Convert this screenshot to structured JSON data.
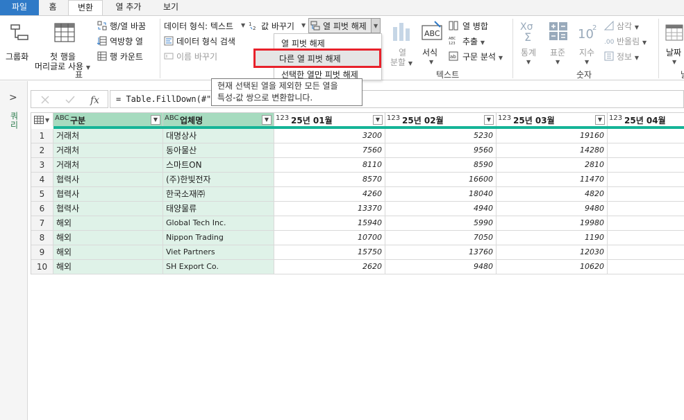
{
  "tabs": {
    "file": "파일",
    "home": "홈",
    "transform": "변환",
    "add_column": "열 추가",
    "view": "보기"
  },
  "ribbon": {
    "group_by": "그룹화",
    "use_first_row_1": "첫 행을",
    "use_first_row_2": "머리글로 사용",
    "transpose": "행/열 바꿈",
    "reverse_rows": "역방향 열",
    "count_rows": "행 카운트",
    "table_group": "표",
    "data_type": "데이터 형식: 텍스트",
    "detect_type": "데이터 형식 검색",
    "rename": "이름 바꾸기",
    "replace_values": "값 바꾸기",
    "unpivot": "열 피벗 해제",
    "split_col_1": "열",
    "split_col_2": "분할",
    "format": "서식",
    "merge_cols": "열 병합",
    "extract": "추출",
    "parse": "구문 분석",
    "text_group": "텍스트",
    "statistics": "통계",
    "standard": "표준",
    "scientific": "지수",
    "trig": "삼각",
    "rounding": "반올림",
    "information": "정보",
    "number_group": "숫자",
    "date": "날짜",
    "date_partial": "날"
  },
  "dropdown": {
    "item1": "열 피벗 해제",
    "item2": "다른 열 피벗 해제",
    "item3": "선택한 열만 피벗 해제"
  },
  "tooltip": {
    "line1": "현재 선택된 열을 제외한 모든 열을",
    "line2": "특성-값 쌍으로 변환합니다."
  },
  "left_pane": {
    "label": "쿼리"
  },
  "formula": "= Table.FillDown(#\"변",
  "columns": [
    {
      "type": "ABC",
      "name": "구분"
    },
    {
      "type": "ABC",
      "name": "업체명"
    },
    {
      "type": "123",
      "name": "25년 01월"
    },
    {
      "type": "123",
      "name": "25년 02월"
    },
    {
      "type": "123",
      "name": "25년 03월"
    },
    {
      "type": "123",
      "name": "25년 04월"
    }
  ],
  "rows": [
    {
      "n": "1",
      "cat": "거래처",
      "company": "대명상사",
      "m1": "3200",
      "m2": "5230",
      "m3": "19160"
    },
    {
      "n": "2",
      "cat": "거래처",
      "company": "동아물산",
      "m1": "7560",
      "m2": "9560",
      "m3": "14280"
    },
    {
      "n": "3",
      "cat": "거래처",
      "company": "스마트ON",
      "m1": "8110",
      "m2": "8590",
      "m3": "2810"
    },
    {
      "n": "4",
      "cat": "협력사",
      "company": "(주)한빛전자",
      "m1": "8570",
      "m2": "16600",
      "m3": "11470"
    },
    {
      "n": "5",
      "cat": "협력사",
      "company": "한국소재㈜",
      "m1": "4260",
      "m2": "18040",
      "m3": "4820"
    },
    {
      "n": "6",
      "cat": "협력사",
      "company": "태양물류",
      "m1": "13370",
      "m2": "4940",
      "m3": "9480"
    },
    {
      "n": "7",
      "cat": "해외",
      "company": "Global Tech Inc.",
      "m1": "15940",
      "m2": "5990",
      "m3": "19980"
    },
    {
      "n": "8",
      "cat": "해외",
      "company": "Nippon Trading",
      "m1": "10700",
      "m2": "7050",
      "m3": "1190"
    },
    {
      "n": "9",
      "cat": "해외",
      "company": "Viet Partners",
      "m1": "15750",
      "m2": "13760",
      "m3": "12030"
    },
    {
      "n": "10",
      "cat": "해외",
      "company": "SH Export Co.",
      "m1": "2620",
      "m2": "9480",
      "m3": "10620"
    }
  ]
}
